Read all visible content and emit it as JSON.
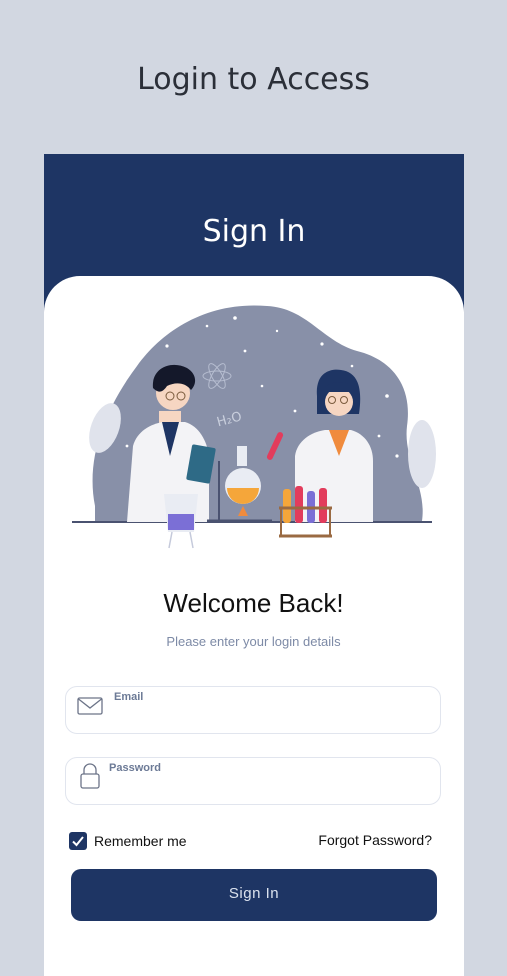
{
  "page": {
    "title": "Login to Access"
  },
  "header": {
    "title": "Sign In"
  },
  "illustration": {
    "formula_text": "H₂O"
  },
  "form": {
    "welcome": "Welcome Back!",
    "subtitle": "Please enter your login details",
    "email": {
      "label": "Email",
      "value": "",
      "icon": "envelope-icon"
    },
    "password": {
      "label": "Password",
      "value": "",
      "icon": "lock-icon"
    },
    "remember_label": "Remember me",
    "remember_checked": true,
    "forgot_label": "Forgot Password?",
    "submit_label": "Sign In"
  },
  "colors": {
    "background": "#d2d7e1",
    "brand": "#1e3564",
    "card": "#ffffff",
    "muted_text": "#7d8aa6"
  }
}
